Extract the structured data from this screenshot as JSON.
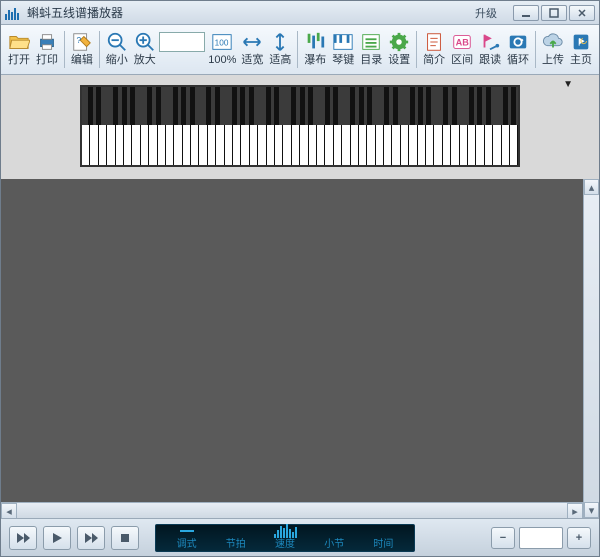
{
  "window": {
    "title": "蝌蚪五线谱播放器",
    "upgrade": "升级"
  },
  "toolbar": {
    "open": "打开",
    "print": "打印",
    "edit": "编辑",
    "zoom_out": "缩小",
    "zoom_in": "放大",
    "zoom_value": "",
    "zoom_100": "100%",
    "fit_width": "适宽",
    "fit_height": "适高",
    "waterfall": "瀑布",
    "keyboard": "琴键",
    "catalog": "目录",
    "settings": "设置",
    "intro": "简介",
    "range": "区间",
    "follow": "跟读",
    "loop": "循环",
    "upload": "上传",
    "home": "主页"
  },
  "transport": {
    "mode": "调式",
    "beat": "节拍",
    "tempo": "速度",
    "measure": "小节",
    "time": "时间"
  },
  "colors": {
    "accent": "#2aa8e0",
    "toolbar_bg": "#e5edf5",
    "content_bg": "#5a5a5a"
  }
}
